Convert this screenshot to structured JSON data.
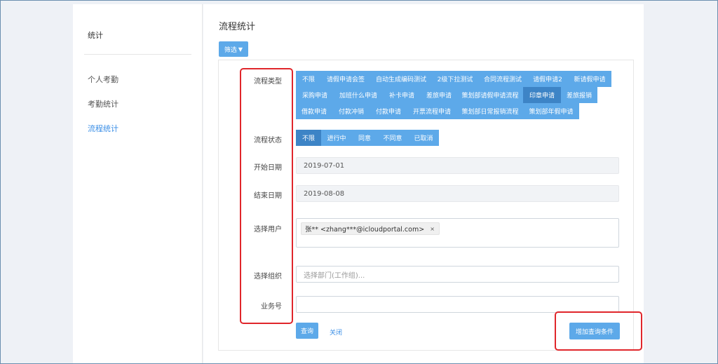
{
  "sidebar": {
    "title": "统计",
    "items": [
      {
        "label": "个人考勤"
      },
      {
        "label": "考勤统计"
      },
      {
        "label": "流程统计"
      }
    ]
  },
  "main": {
    "title": "流程统计",
    "filter_label": "筛选",
    "filter_icon": "filter-icon"
  },
  "form": {
    "labels": {
      "type": "流程类型",
      "status": "流程状态",
      "start": "开始日期",
      "end": "结束日期",
      "user": "选择用户",
      "org": "选择组织",
      "biz": "业务号"
    },
    "type_tags": [
      "不限",
      "请假申请会签",
      "自动生成编码测试",
      "2级下拉测试",
      "合同流程测试",
      "请假申请2",
      "新请假申请",
      "采购申请",
      "加班什么申请",
      "补卡申请",
      "差旅申请",
      "策划部请假申请流程",
      "印章申请",
      "差旅报销",
      "借款申请",
      "付款冲销",
      "付款申请",
      "开票流程申请",
      "策划部日常报销流程",
      "策划部年假申请"
    ],
    "selected_type": "印章申请",
    "status_tags": [
      "不限",
      "进行中",
      "同意",
      "不同意",
      "已取消"
    ],
    "selected_status": "不限",
    "start_date": "2019-07-01",
    "end_date": "2019-08-08",
    "user_chip": "张**  <zhang***@icloudportal.com>",
    "user_chip_close": "×",
    "org_placeholder": "选择部门(工作组)...",
    "biz_value": "",
    "query_button": "查询",
    "close_link": "关闭",
    "add_condition_button": "增加查询条件"
  },
  "colors": {
    "accent": "#5da9e9",
    "accent_selected": "#3d84c6",
    "link": "#3a8ee6",
    "annotation": "#e0262b"
  }
}
